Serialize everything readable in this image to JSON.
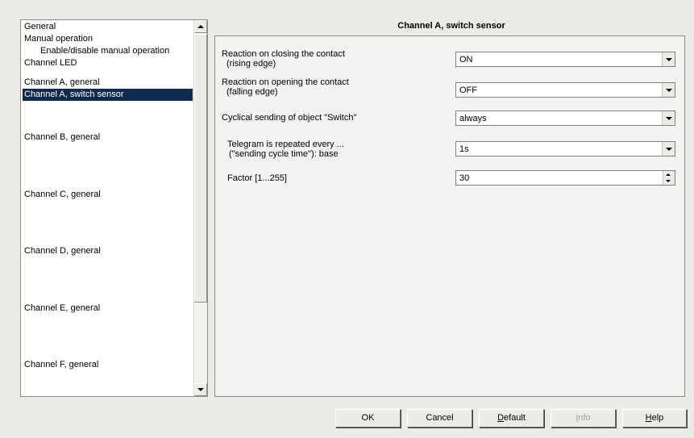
{
  "tree": {
    "items": [
      {
        "label": "General",
        "indent": false,
        "selected": false
      },
      {
        "label": "Manual operation",
        "indent": false,
        "selected": false
      },
      {
        "label": "Enable/disable manual operation",
        "indent": true,
        "selected": false
      },
      {
        "label": "Channel LED",
        "indent": false,
        "selected": false
      },
      {
        "label": "Channel A, general",
        "indent": false,
        "selected": false
      },
      {
        "label": "Channel A, switch sensor",
        "indent": false,
        "selected": true
      },
      {
        "label": "Channel B, general",
        "indent": false,
        "selected": false
      },
      {
        "label": "Channel C, general",
        "indent": false,
        "selected": false
      },
      {
        "label": "Channel D, general",
        "indent": false,
        "selected": false
      },
      {
        "label": "Channel E, general",
        "indent": false,
        "selected": false
      },
      {
        "label": "Channel F, general",
        "indent": false,
        "selected": false
      }
    ]
  },
  "page": {
    "title": "Channel A, switch sensor"
  },
  "params": {
    "closing": {
      "label_line1": "Reaction on closing the contact",
      "label_line2": "(rising edge)",
      "value": "ON"
    },
    "opening": {
      "label_line1": "Reaction on opening the contact",
      "label_line2": "(falling edge)",
      "value": "OFF"
    },
    "cyclical": {
      "label": "Cyclical sending of object \"Switch\"",
      "value": "always"
    },
    "repeat": {
      "label_line1": "Telegram is repeated every ...",
      "label_line2": "(\"sending cycle time\"): base",
      "value": "1s"
    },
    "factor": {
      "label": "Factor [1...255]",
      "value": "30"
    }
  },
  "buttons": {
    "ok": "OK",
    "cancel": "Cancel",
    "default_first": "D",
    "default_rest": "efault",
    "info_first": "I",
    "info_rest": "nfo",
    "help_first": "H",
    "help_rest": "elp"
  }
}
